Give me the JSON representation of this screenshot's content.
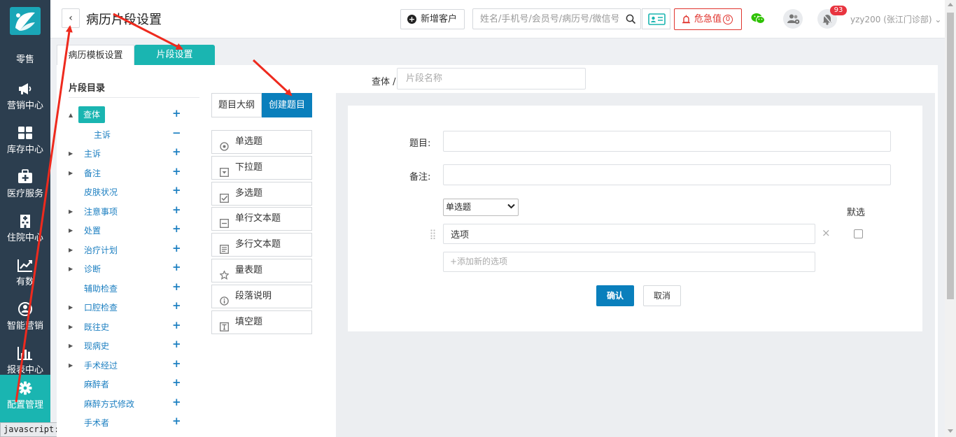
{
  "nav": {
    "items": [
      {
        "label": "零售",
        "icon": "retail-icon"
      },
      {
        "label": "营销中心",
        "icon": "megaphone-icon"
      },
      {
        "label": "库存中心",
        "icon": "grid-icon"
      },
      {
        "label": "医疗服务",
        "icon": "medkit-icon"
      },
      {
        "label": "住院中心",
        "icon": "hospital-icon"
      },
      {
        "label": "有数",
        "icon": "trend-icon"
      },
      {
        "label": "智能营销",
        "icon": "smart-marketing-icon"
      },
      {
        "label": "报表中心",
        "icon": "bar-chart-icon"
      },
      {
        "label": "配置管理",
        "icon": "gear-icon"
      }
    ],
    "active_index": 8
  },
  "status_bar": {
    "text": "javascript:;"
  },
  "header": {
    "back_label": "‹",
    "title": "病历片段设置",
    "new_customer": "新增客户",
    "search_placeholder": "姓名/手机号/会员号/病历号/微信号",
    "critical_label": "危急值",
    "critical_count": "0",
    "notif_count": "93",
    "user": "yzy200 (张江门诊部)"
  },
  "tabs": [
    {
      "label": "病历模板设置",
      "active": false
    },
    {
      "label": "片段设置",
      "active": true
    }
  ],
  "tree": {
    "title": "片段目录",
    "items": [
      {
        "label": "查体",
        "caret": "▲",
        "btn": "+",
        "selected": true,
        "indent": 1
      },
      {
        "label": "主诉",
        "caret": "",
        "btn": "−",
        "selected": false,
        "indent": 2
      },
      {
        "label": "主诉",
        "caret": "▶",
        "btn": "+",
        "selected": false,
        "indent": 1
      },
      {
        "label": "备注",
        "caret": "▶",
        "btn": "+",
        "selected": false,
        "indent": 1
      },
      {
        "label": "皮肤状况",
        "caret": "",
        "btn": "+",
        "selected": false,
        "indent": 1
      },
      {
        "label": "注意事项",
        "caret": "▶",
        "btn": "+",
        "selected": false,
        "indent": 1
      },
      {
        "label": "处置",
        "caret": "▶",
        "btn": "+",
        "selected": false,
        "indent": 1
      },
      {
        "label": "治疗计划",
        "caret": "▶",
        "btn": "+",
        "selected": false,
        "indent": 1
      },
      {
        "label": "诊断",
        "caret": "▶",
        "btn": "+",
        "selected": false,
        "indent": 1
      },
      {
        "label": "辅助检查",
        "caret": "",
        "btn": "+",
        "selected": false,
        "indent": 1
      },
      {
        "label": "口腔检查",
        "caret": "▶",
        "btn": "+",
        "selected": false,
        "indent": 1
      },
      {
        "label": "既往史",
        "caret": "▶",
        "btn": "+",
        "selected": false,
        "indent": 1
      },
      {
        "label": "现病史",
        "caret": "▶",
        "btn": "+",
        "selected": false,
        "indent": 1
      },
      {
        "label": "手术经过",
        "caret": "▶",
        "btn": "+",
        "selected": false,
        "indent": 1
      },
      {
        "label": "麻醉者",
        "caret": "",
        "btn": "+",
        "selected": false,
        "indent": 1
      },
      {
        "label": "麻醉方式修改",
        "caret": "",
        "btn": "+",
        "selected": false,
        "indent": 1
      },
      {
        "label": "手术者",
        "caret": "",
        "btn": "+",
        "selected": false,
        "indent": 1
      }
    ]
  },
  "tools": {
    "outline_label": "题目大纲",
    "create_label": "创建题目",
    "types": [
      {
        "label": "单选题",
        "icon": "radio-icon"
      },
      {
        "label": "下拉题",
        "icon": "dropdown-icon"
      },
      {
        "label": "多选题",
        "icon": "checkbox-icon"
      },
      {
        "label": "单行文本题",
        "icon": "single-line-icon"
      },
      {
        "label": "多行文本题",
        "icon": "multi-line-icon"
      },
      {
        "label": "量表题",
        "icon": "star-icon"
      },
      {
        "label": "段落说明",
        "icon": "info-icon"
      },
      {
        "label": "填空题",
        "icon": "fill-blank-icon"
      }
    ]
  },
  "editor": {
    "crumb": "查体 /",
    "segment_name_placeholder": "片段名称",
    "question_label": "题目:",
    "note_label": "备注:",
    "type_selected": "单选题",
    "default_label": "默选",
    "option_value": "选项",
    "option_remove": "×",
    "add_option_placeholder": "+添加新的选项",
    "confirm_label": "确认",
    "cancel_label": "取消"
  },
  "colors": {
    "nav_bg": "#2c3e4f",
    "teal": "#1ab5b1",
    "blue": "#0a7fbc",
    "link": "#1c7fc1",
    "danger": "#e0342e",
    "annotation": "#ee2a1e"
  }
}
